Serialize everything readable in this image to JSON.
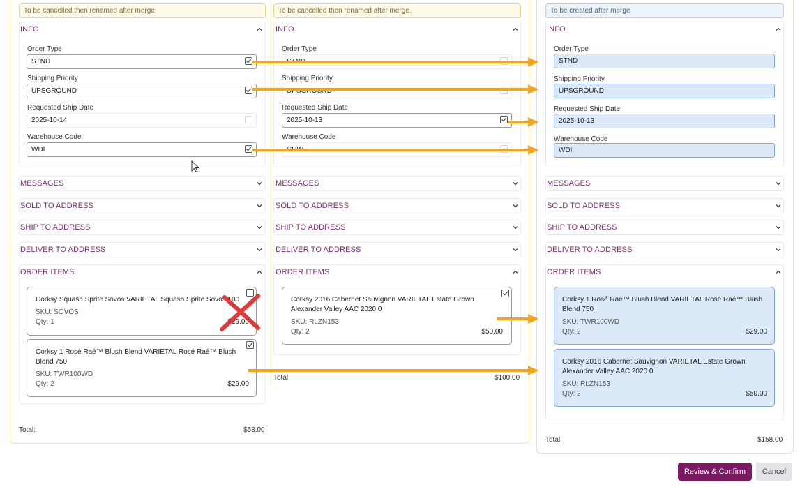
{
  "banners": {
    "order_a": "To be cancelled then renamed after merge.",
    "order_b": "To be cancelled then renamed after merge.",
    "merged": "To be created after merge"
  },
  "sections": {
    "info": "INFO",
    "messages": "MESSAGES",
    "sold_to": "SOLD TO ADDRESS",
    "ship_to": "SHIP TO ADDRESS",
    "deliver_to": "DELIVER TO ADDRESS",
    "order_items": "ORDER ITEMS"
  },
  "labels": {
    "order_type": "Order Type",
    "shipping_priority": "Shipping Priority",
    "requested_ship_date": "Requested Ship Date",
    "warehouse_code": "Warehouse Code",
    "total": "Total:"
  },
  "order_a": {
    "order_type": "STND",
    "shipping_priority": "UPSGROUND",
    "requested_ship_date": "2025-10-14",
    "warehouse_code": "WDI",
    "items": [
      {
        "name": "Corksy Squash Sprite Sovos VARIETAL Squash Sprite Sovos 100",
        "sku": "SKU: SOVOS",
        "qty": "Qty: 1",
        "price": "$29.00"
      },
      {
        "name": "Corksy 1 Rosé Raé™ Blush Blend VARIETAL Rosé Raé™ Blush Blend 750",
        "sku": "SKU: TWR100WD",
        "qty": "Qty: 2",
        "price": "$29.00"
      }
    ],
    "total": "$58.00"
  },
  "order_b": {
    "order_type": "STND",
    "shipping_priority": "UPSGROUND",
    "requested_ship_date": "2025-10-13",
    "warehouse_code": "CHW",
    "items": [
      {
        "name": "Corksy 2016 Cabernet Sauvignon VARIETAL Estate Grown Alexander Valley AAC 2020 0",
        "sku": "SKU: RLZN153",
        "qty": "Qty: 2",
        "price": "$50.00"
      }
    ],
    "total": "$100.00"
  },
  "merged": {
    "order_type": "STND",
    "shipping_priority": "UPSGROUND",
    "requested_ship_date": "2025-10-13",
    "warehouse_code": "WDI",
    "items": [
      {
        "name": "Corksy 1 Rosé Raé™ Blush Blend VARIETAL Rosé Raé™ Blush Blend 750",
        "sku": "SKU: TWR100WD",
        "qty": "Qty: 2",
        "price": "$29.00"
      },
      {
        "name": "Corksy 2016 Cabernet Sauvignon VARIETAL Estate Grown Alexander Valley AAC 2020 0",
        "sku": "SKU: RLZN153",
        "qty": "Qty: 2",
        "price": "$50.00"
      }
    ],
    "total": "$158.00"
  },
  "buttons": {
    "review_confirm": "Review & Confirm",
    "cancel": "Cancel"
  },
  "colors": {
    "accent": "#7a2f6e",
    "primary_button": "#7b1a63",
    "arrow": "#f0a51c",
    "cross": "#e03a3a",
    "selected_fill": "#dce9f9"
  },
  "icons": {
    "chevron_up": "chevron-up-icon",
    "chevron_down": "chevron-down-icon",
    "checkbox_checked": "checkbox-checked-icon",
    "checkbox_empty": "checkbox-empty-icon"
  }
}
